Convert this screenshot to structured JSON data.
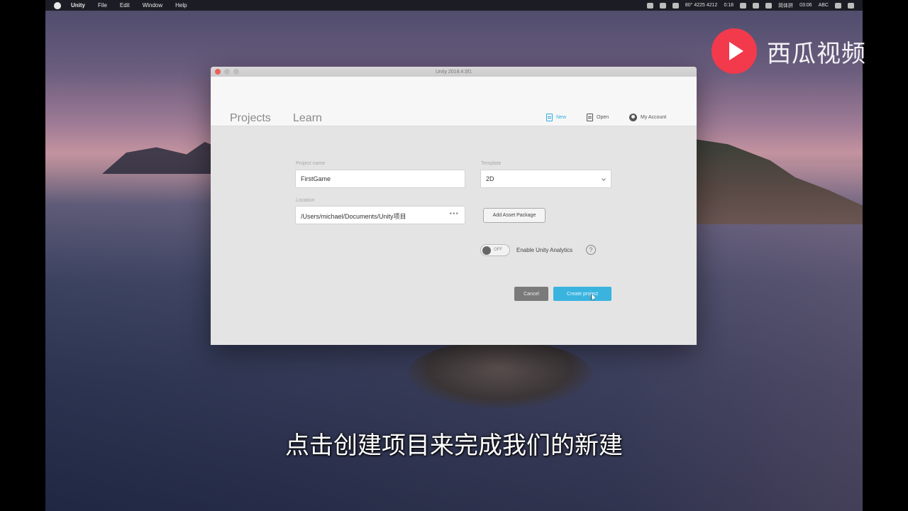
{
  "menubar": {
    "app_name": "Unity",
    "items": [
      "File",
      "Edit",
      "Window",
      "Help"
    ],
    "status_text": "80° 4225 4212",
    "status_time_small": "0:18",
    "input_method": "简体拼",
    "clock": "03:06",
    "keyboard": "ABC"
  },
  "window": {
    "title": "Unity 2018.4.5f1",
    "tabs": {
      "projects": "Projects",
      "learn": "Learn"
    },
    "header_buttons": {
      "new": "New",
      "open": "Open",
      "account": "My Account"
    },
    "form": {
      "project_name_label": "Project name",
      "project_name_value": "FirstGame",
      "template_label": "Template",
      "template_value": "2D",
      "location_label": "Location",
      "location_value": "/Users/michael/Documents/Unity项目",
      "location_browse": "•••",
      "add_asset_package": "Add Asset Package",
      "analytics_toggle": "OFF",
      "analytics_label": "Enable Unity Analytics",
      "help": "?"
    },
    "buttons": {
      "cancel": "Cancel",
      "create": "Create project"
    }
  },
  "watermark": {
    "text": "西瓜视频"
  },
  "subtitle": {
    "text": "点击创建项目来完成我们的新建"
  },
  "colors": {
    "accent": "#3ab4df",
    "logo": "#f23a4c"
  }
}
